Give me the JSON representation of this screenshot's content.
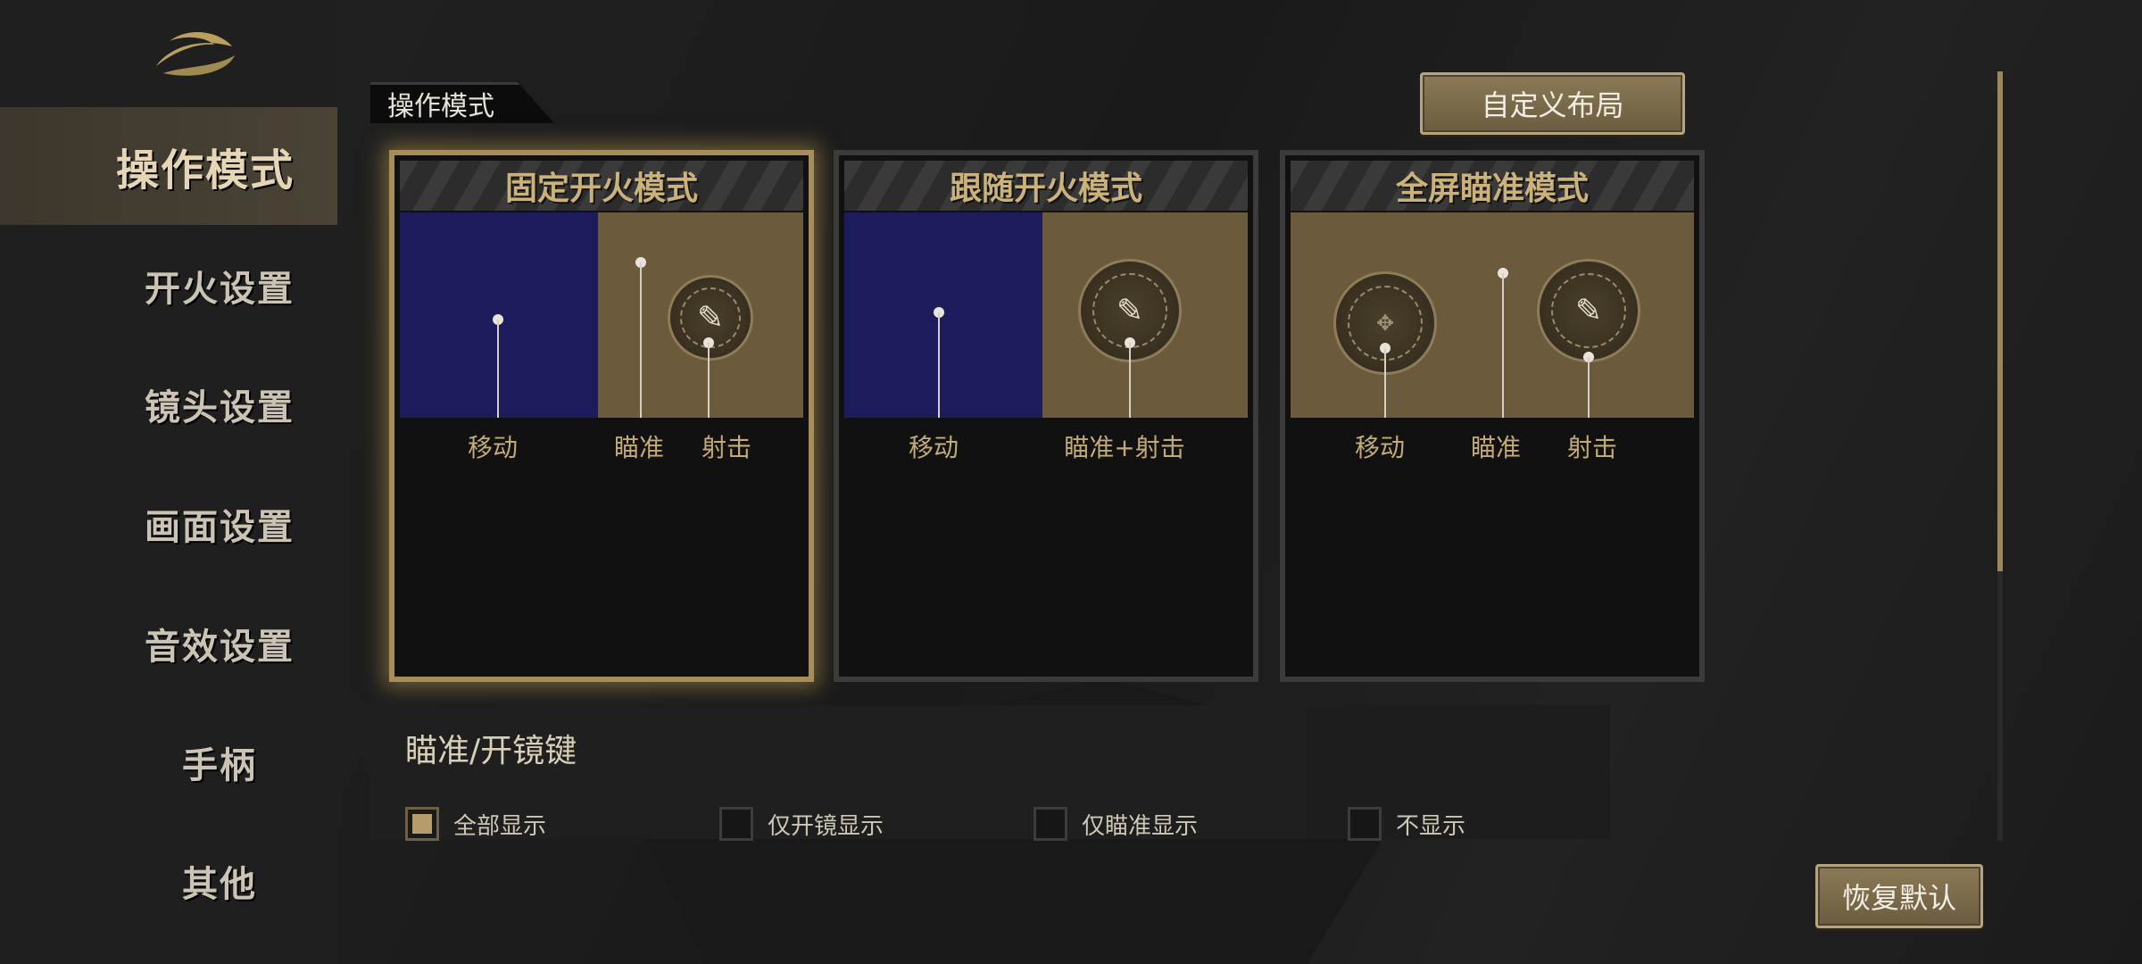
{
  "sidebar": {
    "items": [
      {
        "label": "操作模式"
      },
      {
        "label": "开火设置"
      },
      {
        "label": "镜头设置"
      },
      {
        "label": "画面设置"
      },
      {
        "label": "音效设置"
      },
      {
        "label": "手柄"
      },
      {
        "label": "其他"
      }
    ]
  },
  "section": {
    "title": "操作模式"
  },
  "buttons": {
    "custom_layout": "自定义布局",
    "restore_default": "恢复默认"
  },
  "modes": [
    {
      "title": "固定开火模式",
      "selected": true,
      "captions": [
        "移动",
        "瞄准",
        "射击"
      ]
    },
    {
      "title": "跟随开火模式",
      "selected": false,
      "captions": [
        "移动",
        "瞄准+射击"
      ]
    },
    {
      "title": "全屏瞄准模式",
      "selected": false,
      "captions": [
        "移动",
        "瞄准",
        "射击"
      ]
    }
  ],
  "aim_scope": {
    "title": "瞄准/开镜键",
    "options": [
      {
        "label": "全部显示",
        "checked": true
      },
      {
        "label": "仅开镜显示",
        "checked": false
      },
      {
        "label": "仅瞄准显示",
        "checked": false
      },
      {
        "label": "不显示",
        "checked": false
      }
    ]
  },
  "colors": {
    "accent_gold": "#b49d6a",
    "move_zone": "#1d1b5c",
    "aim_zone": "#6b5a3c"
  }
}
